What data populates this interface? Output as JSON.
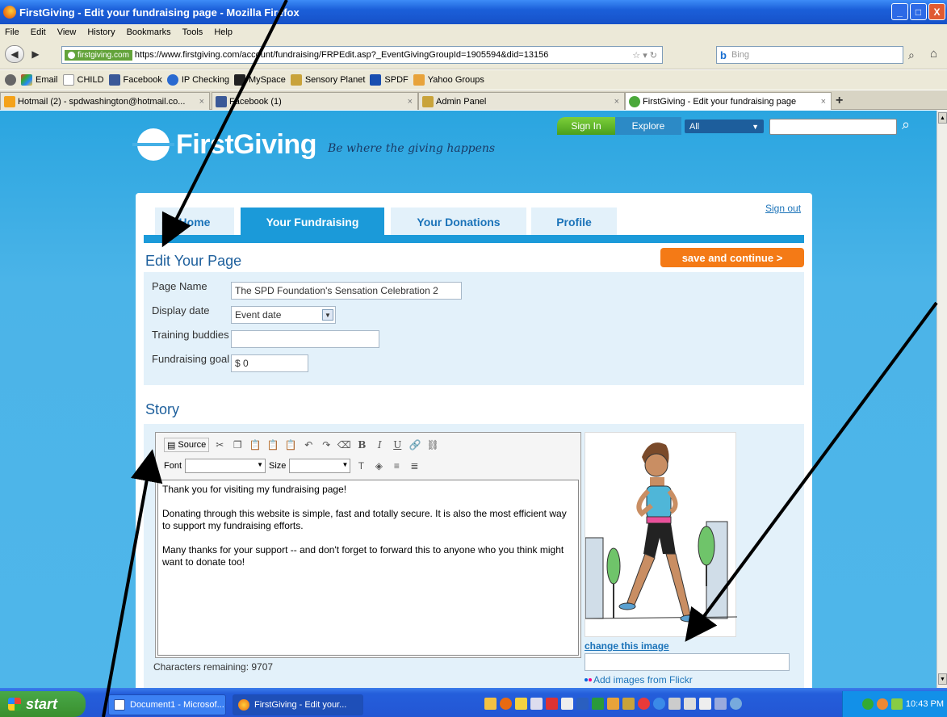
{
  "window": {
    "title": "FirstGiving - Edit your fundraising page - Mozilla Firefox",
    "min": "_",
    "max": "□",
    "close": "X"
  },
  "menu": [
    "File",
    "Edit",
    "View",
    "History",
    "Bookmarks",
    "Tools",
    "Help"
  ],
  "nav": {
    "site_badge": "firstgiving.com",
    "url": "https://www.firstgiving.com/account/fundraising/FRPEdit.asp?_EventGivingGroupId=1905594&did=13156",
    "search_engine": "Bing"
  },
  "bookmarks": [
    "Email",
    "CHILD",
    "Facebook",
    "IP Checking",
    "MySpace",
    "Sensory Planet",
    "SPDF",
    "Yahoo Groups"
  ],
  "tabs": [
    {
      "label": "Hotmail (2) - spdwashington@hotmail.co..."
    },
    {
      "label": "Facebook (1)"
    },
    {
      "label": "Admin Panel"
    },
    {
      "label": "FirstGiving - Edit your fundraising page"
    }
  ],
  "site": {
    "sign_in": "Sign In",
    "explore": "Explore",
    "search_scope": "All",
    "brand": "FirstGiving",
    "tagline": "Be where the giving happens",
    "sign_out": "Sign out",
    "tabs": [
      "Home",
      "Your Fundraising",
      "Your Donations",
      "Profile"
    ]
  },
  "edit": {
    "title": "Edit Your Page",
    "save_button": "save and continue >",
    "page_name_label": "Page Name",
    "page_name_value": "The SPD Foundation's Sensation Celebration 2",
    "display_date_label": "Display date",
    "display_date_value": "Event date",
    "training_label": "Training buddies",
    "training_value": "",
    "goal_label": "Fundraising goal",
    "goal_value": "$ 0"
  },
  "story": {
    "title": "Story",
    "source_label": "Source",
    "font_label": "Font",
    "size_label": "Size",
    "paragraphs": [
      "Thank you for visiting my fundraising page!",
      "Donating through this website is simple, fast and totally secure. It is also the most efficient way to support my fundraising efforts.",
      "Many thanks for your support -- and don't forget to forward this to anyone who you think might want to donate too!"
    ],
    "chars_remaining": "Characters remaining: 9707",
    "change_image": "change this image",
    "flickr": "Add images from Flickr"
  },
  "taskbar": {
    "start": "start",
    "tasks": [
      "Document1 - Microsof...",
      "FirstGiving - Edit your..."
    ],
    "clock": "10:43 PM"
  }
}
